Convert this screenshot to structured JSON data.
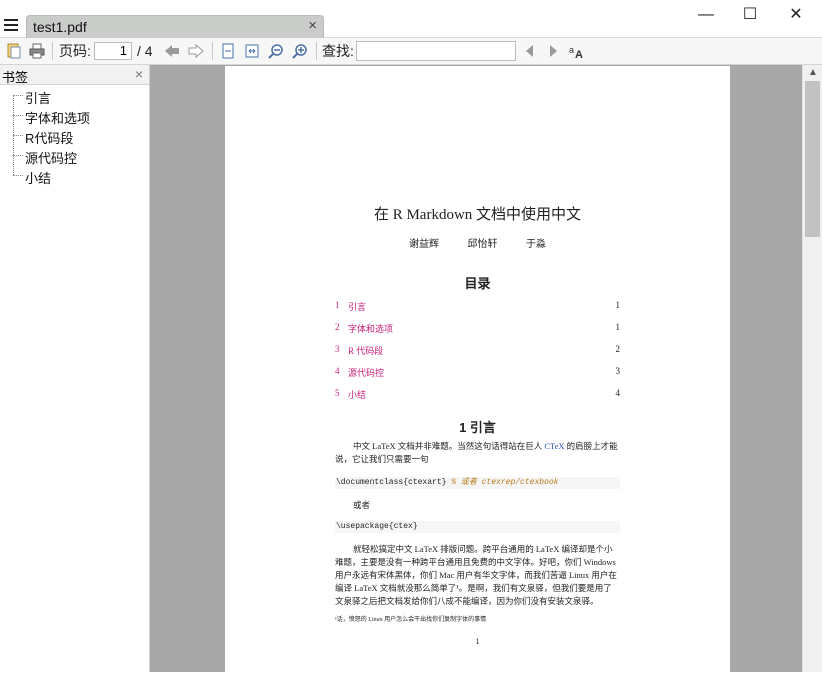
{
  "window": {
    "tab_title": "test1.pdf",
    "tab_close": "×",
    "minimize": "—",
    "maximize": "☐",
    "close": "✕"
  },
  "toolbar": {
    "page_label": "页码:",
    "page_current": "1",
    "page_total": "/ 4",
    "find_label": "查找:",
    "find_value": "",
    "icons": [
      "open-icon",
      "print-icon",
      "back-arrow-icon",
      "forward-arrow-icon",
      "fit-page-icon",
      "fit-width-icon",
      "zoom-out-icon",
      "zoom-in-icon",
      "find-prev-icon",
      "find-next-icon",
      "match-case-icon"
    ]
  },
  "sidebar": {
    "title": "书签",
    "close": "×",
    "bookmarks": [
      "引言",
      "字体和选项",
      "R代码段",
      "源代码控",
      "小结"
    ]
  },
  "document": {
    "title": "在 R Markdown 文档中使用中文",
    "authors": "谢益辉 邱怡轩 于淼",
    "toc_heading": "目录",
    "toc": [
      {
        "num": "1",
        "label": "引言",
        "page": "1"
      },
      {
        "num": "2",
        "label": "字体和选项",
        "page": "1"
      },
      {
        "num": "3",
        "label": "R 代码段",
        "page": "2"
      },
      {
        "num": "4",
        "label": "源代码控",
        "page": "3"
      },
      {
        "num": "5",
        "label": "小结",
        "page": "4"
      }
    ],
    "section_heading": "1 引言",
    "para1_a": "中文 LaTeX 文档并非难题。当然这句话得站在巨人 ",
    "para1_link": "CTeX",
    "para1_b": " 的肩膀上才能说，它让我们只需要一句",
    "code1": "\\documentclass{ctexart}",
    "code1_comment": "% 或者 ctexrep/ctexbook",
    "or_text": "或者",
    "code2": "\\usepackage{ctex}",
    "para2": "就轻松搞定中文 LaTeX 排版问题。跨平台通用的 LaTeX 编译却是个小难题，主要是没有一种跨平台通用且免费的中文字体。好吧，你们 Windows 用户永远有宋体黑体，你们 Mac 用户有华文字体，而我们苦逼 Linux 用户在编译 LaTeX 文档就没那么简单了¹。是啊，我们有文泉驿，但我们要是用了文泉驿之后把文档发给你们八成不能编译，因为你们没有安装文泉驿。",
    "footnote": "¹话，愤怒的 Linux 用户怎么会干出找你们复制字体的事情",
    "page_number": "1"
  }
}
